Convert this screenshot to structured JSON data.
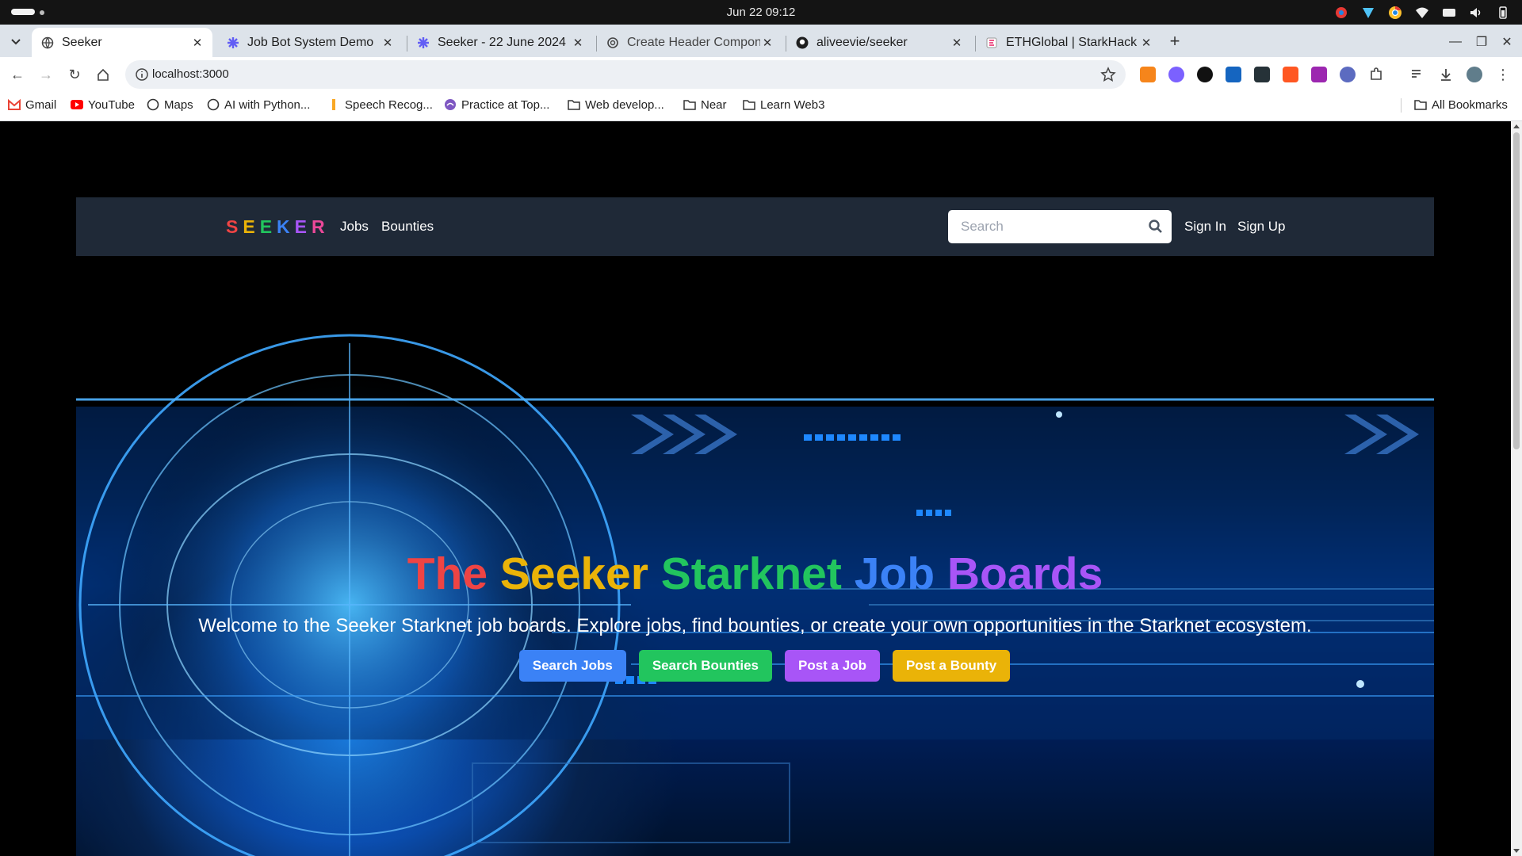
{
  "os": {
    "clock": "Jun 22  09:12"
  },
  "browser": {
    "tabs": [
      {
        "label": "Seeker",
        "active": true,
        "icon": "globe-icon"
      },
      {
        "label": "Job Bot System Demo",
        "active": false,
        "icon": "loom-icon"
      },
      {
        "label": "Seeker - 22 June 2024",
        "active": false,
        "icon": "loom-icon"
      },
      {
        "label": "Create Header Compone",
        "active": false,
        "icon": "openai-icon"
      },
      {
        "label": "aliveevie/seeker",
        "active": false,
        "icon": "github-icon"
      },
      {
        "label": "ETHGlobal | StarkHack",
        "active": false,
        "icon": "ethglobal-icon"
      }
    ],
    "url": "localhost:3000",
    "bookmarks": [
      {
        "label": "Gmail",
        "icon": "gmail-icon"
      },
      {
        "label": "YouTube",
        "icon": "youtube-icon"
      },
      {
        "label": "Maps",
        "icon": "globe-icon"
      },
      {
        "label": "AI with Python...",
        "icon": "globe-icon"
      },
      {
        "label": "Speech Recog...",
        "icon": "page-icon"
      },
      {
        "label": "Practice at Top...",
        "icon": "practice-icon"
      },
      {
        "label": "Web develop...",
        "icon": "folder-icon"
      },
      {
        "label": "Near",
        "icon": "folder-icon"
      },
      {
        "label": "Learn Web3",
        "icon": "folder-icon"
      }
    ],
    "all_bookmarks": "All Bookmarks"
  },
  "site": {
    "logo_letters": [
      {
        "char": "S",
        "color": "#ef4444"
      },
      {
        "char": "E",
        "color": "#eab308"
      },
      {
        "char": "E",
        "color": "#22c55e"
      },
      {
        "char": "K",
        "color": "#3b82f6"
      },
      {
        "char": "E",
        "color": "#a855f7"
      },
      {
        "char": "R",
        "color": "#ec4899"
      }
    ],
    "nav": {
      "jobs": "Jobs",
      "bounties": "Bounties"
    },
    "search": {
      "placeholder": "Search"
    },
    "auth": {
      "sign_in": "Sign In",
      "sign_up": "Sign Up"
    }
  },
  "hero": {
    "title_words": [
      {
        "text": "The",
        "color": "#ef4444"
      },
      {
        "text": "Seeker",
        "color": "#eab308"
      },
      {
        "text": "Starknet",
        "color": "#22c55e"
      },
      {
        "text": "Job",
        "color": "#3b82f6"
      },
      {
        "text": "Boards",
        "color": "#a855f7"
      }
    ],
    "subtitle": "Welcome to the Seeker Starknet job boards. Explore jobs, find bounties, or create your own opportunities in the Starknet ecosystem.",
    "buttons": [
      {
        "label": "Search Jobs",
        "color": "#3b82f6"
      },
      {
        "label": "Search Bounties",
        "color": "#22c55e"
      },
      {
        "label": "Post a Job",
        "color": "#a855f7"
      },
      {
        "label": "Post a Bounty",
        "color": "#eab308"
      }
    ]
  }
}
